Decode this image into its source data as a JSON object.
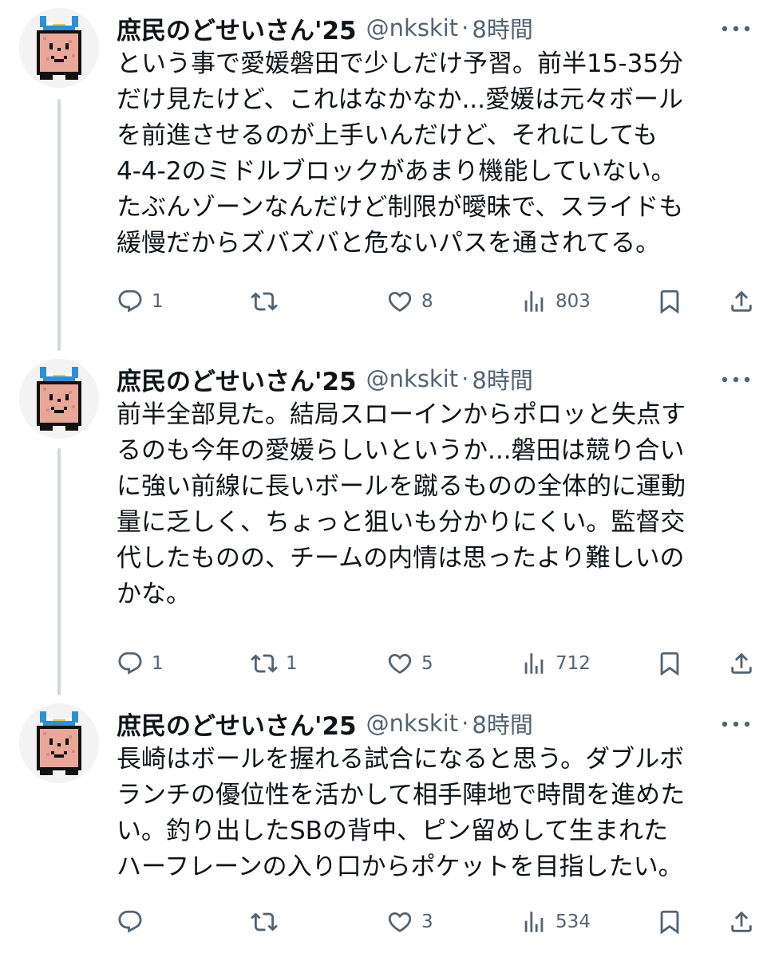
{
  "tweets": [
    {
      "name": "庶民のどせいさん'25",
      "handle": "@nkskit",
      "separator": "·",
      "time": "8時間",
      "lines": [
        "という事で愛媛磐田で少しだけ予習。前半15-35分",
        "だけ見たけど、これはなかなか...愛媛は元々ボール",
        "を前進させるのが上手いんだけど、それにしても",
        "4-4-2のミドルブロックがあまり機能していない。",
        "たぶんゾーンなんだけど制限が曖昧で、スライドも",
        "緩慢だからズバズバと危ないパスを通されてる。"
      ],
      "replies": "1",
      "retweets": "",
      "likes": "8",
      "views": "803"
    },
    {
      "name": "庶民のどせいさん'25",
      "handle": "@nkskit",
      "separator": "·",
      "time": "8時間",
      "lines": [
        "前半全部見た。結局スローインからポロッと失点す",
        "るのも今年の愛媛らしいというか...磐田は競り合い",
        "に強い前線に長いボールを蹴るものの全体的に運動",
        "量に乏しく、ちょっと狙いも分かりにくい。監督交",
        "代したものの、チームの内情は思ったより難しいの",
        "かな。"
      ],
      "replies": "1",
      "retweets": "1",
      "likes": "5",
      "views": "712"
    },
    {
      "name": "庶民のどせいさん'25",
      "handle": "@nkskit",
      "separator": "·",
      "time": "8時間",
      "lines": [
        "長崎はボールを握れる試合になると思う。ダブルボ",
        "ランチの優位性を活かして相手陣地で時間を進めた",
        "い。釣り出したSBの背中、ピン留めして生まれた",
        "ハーフレーンの入り口からポケットを目指したい。"
      ],
      "replies": "",
      "retweets": "",
      "likes": "3",
      "views": "534"
    }
  ],
  "icons": {
    "reply": "reply-icon",
    "retweet": "retweet-icon",
    "like": "like-icon",
    "views": "views-icon",
    "bookmark": "bookmark-icon",
    "share": "share-icon",
    "more": "more-icon"
  },
  "colors": {
    "text": "#0f1419",
    "secondary": "#536471",
    "thread_line": "#cfd9de",
    "avatar_skin": "#e9a79a",
    "avatar_hair": "#2d8fd6",
    "avatar_accent": "#f2c53d"
  }
}
